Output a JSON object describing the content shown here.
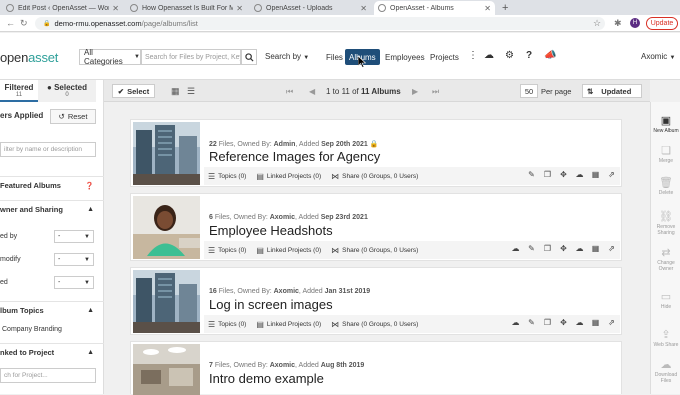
{
  "browser": {
    "tabs": [
      {
        "title": "Edit Post ‹ OpenAsset — Wor...",
        "active": false
      },
      {
        "title": "How Openasset Is Built For M...",
        "active": false
      },
      {
        "title": "OpenAsset - Uploads",
        "active": false
      },
      {
        "title": "OpenAsset - Albums",
        "active": true
      }
    ],
    "url_host": "demo-rmu.openasset.com",
    "url_path": "/page/albums/list",
    "update_label": "Update",
    "profile_initial": "H"
  },
  "header": {
    "logo_prefix": "open",
    "logo_suffix": "asset",
    "category": "All Categories",
    "search_placeholder": "Search for Files by Project, Keyw",
    "search_by": "Search by",
    "nav": [
      "Files",
      "Albums",
      "Employees",
      "Projects"
    ],
    "active_nav": "Albums",
    "user": "Axomic"
  },
  "sidebar": {
    "filtered_label": "Filtered",
    "filtered_count": "11",
    "selected_label": "Selected",
    "selected_count": "0",
    "filters_applied": "ers Applied",
    "reset": "Reset",
    "filter_placeholder": "ilter by name or description",
    "featured": "Featured Albums",
    "owner_sharing": "wner and Sharing",
    "owner_rows": [
      {
        "label": "ed by",
        "value": "-"
      },
      {
        "label": "modify",
        "value": "-"
      },
      {
        "label": "ed",
        "value": "-"
      }
    ],
    "album_topics": "lbum Topics",
    "topic_item": "Company Branding",
    "linked_project": "nked to Project",
    "project_placeholder": "ch for Project..."
  },
  "toolbar": {
    "select": "Select",
    "range": "1 to 11 of",
    "total": "11 Albums",
    "per_page": "50",
    "per_page_label": "Per page",
    "sort": "Updated"
  },
  "albums": [
    {
      "count": "22",
      "owner": "Admin",
      "date": "Sep 20th 2021",
      "title": "Reference Images for Agency",
      "topics": "Topics (0)",
      "linked": "Linked Projects (0)",
      "share": "Share (0 Groups, 0 Users)",
      "locked": true
    },
    {
      "count": "6",
      "owner": "Axomic",
      "date": "Sep 23rd 2021",
      "title": "Employee Headshots",
      "topics": "Topics (0)",
      "linked": "Linked Projects (0)",
      "share": "Share (0 Groups, 0 Users)",
      "locked": false
    },
    {
      "count": "16",
      "owner": "Axomic",
      "date": "Jan 31st 2019",
      "title": "Log in screen images",
      "topics": "Topics (0)",
      "linked": "Linked Projects (0)",
      "share": "Share (0 Groups, 0 Users)",
      "locked": false
    },
    {
      "count": "7",
      "owner": "Axomic",
      "date": "Aug 8th 2019",
      "title": "Intro demo example",
      "topics": "",
      "linked": "",
      "share": "",
      "locked": false
    }
  ],
  "meta_words": {
    "files": "Files, Owned By:",
    "added": "Added"
  },
  "rail": [
    {
      "label": "New Album",
      "icon": "album-plus-icon",
      "enabled": true
    },
    {
      "label": "Merge",
      "icon": "merge-icon",
      "enabled": false
    },
    {
      "label": "Delete",
      "icon": "trash-icon",
      "enabled": false
    },
    {
      "label": "Remove Sharing",
      "icon": "unlink-icon",
      "enabled": false
    },
    {
      "label": "Change Owner",
      "icon": "swap-icon",
      "enabled": false
    },
    {
      "label": "Hide",
      "icon": "hide-icon",
      "enabled": false
    },
    {
      "label": "Web Share",
      "icon": "share-icon",
      "enabled": false
    },
    {
      "label": "Download Files",
      "icon": "download-icon",
      "enabled": false
    }
  ]
}
